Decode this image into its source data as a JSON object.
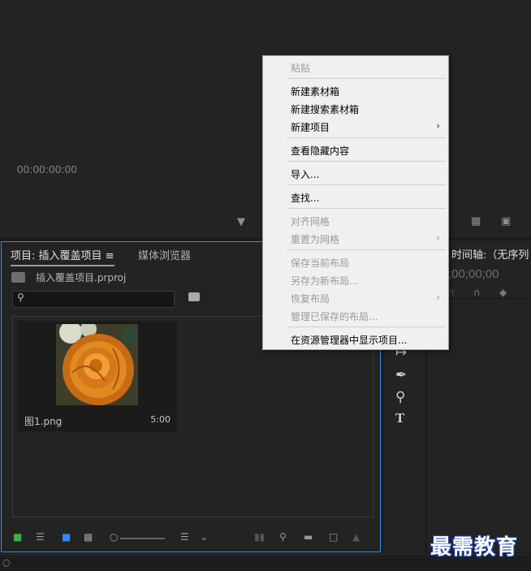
{
  "source_monitor": {
    "timecode": "00:00:00:00"
  },
  "project_panel": {
    "tab_project": "项目: 插入覆盖项目",
    "tab_media": "媒体浏览器",
    "path": "插入覆盖项目.prproj",
    "clip": {
      "name": "图1.png",
      "duration": "5:00"
    }
  },
  "timeline": {
    "title": "时间轴:（无序列",
    "timecode": ";00;00;00"
  },
  "context_menu": {
    "paste": "粘贴",
    "new_bin": "新建素材箱",
    "new_search_bin": "新建搜索素材箱",
    "new_item": "新建项目",
    "view_hidden": "查看隐藏内容",
    "import": "导入...",
    "find": "查找...",
    "align_grid": "对齐网格",
    "reset_grid": "重置为网格",
    "save_layout": "保存当前布局",
    "save_as_layout": "另存为新布局...",
    "restore_layout": "恢复布局",
    "manage_layouts": "管理已保存的布局...",
    "reveal_explorer": "在资源管理器中显示项目..."
  },
  "watermark": "最需教育",
  "colors": {
    "accent": "#2d8ceb",
    "panel": "#232323",
    "menu_bg": "#f0f0f0"
  }
}
